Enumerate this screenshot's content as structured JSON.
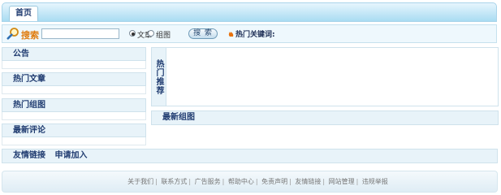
{
  "nav": {
    "home": "首页"
  },
  "search": {
    "label": "搜索",
    "input_value": "",
    "option_article": "文章",
    "option_picture": "组图",
    "selected": "文章",
    "button": "搜 索",
    "hot_keywords": "热门关键词:"
  },
  "left": {
    "notice": "公告",
    "hot_articles": "热门文章",
    "hot_pictures": "热门组图",
    "latest_comments": "最新评论"
  },
  "main": {
    "hot_recommend": "热门推荐",
    "latest_pictures": "最新组图"
  },
  "links": {
    "friend_links": "友情链接",
    "apply_join": "申请加入"
  },
  "footer": {
    "links": [
      "关于我们",
      "联系方式",
      "广告服务",
      "帮助中心",
      "免责声明",
      "友情链接",
      "网站管理",
      "违规举报"
    ]
  },
  "colors": {
    "accent": "#e07d10",
    "header_bg": "#a9dcf2",
    "panel_bg": "#e8f3f9",
    "text": "#1f3b70"
  },
  "icons": {
    "search": "search-magnifier-icon",
    "hot": "hot-flame-icon"
  }
}
